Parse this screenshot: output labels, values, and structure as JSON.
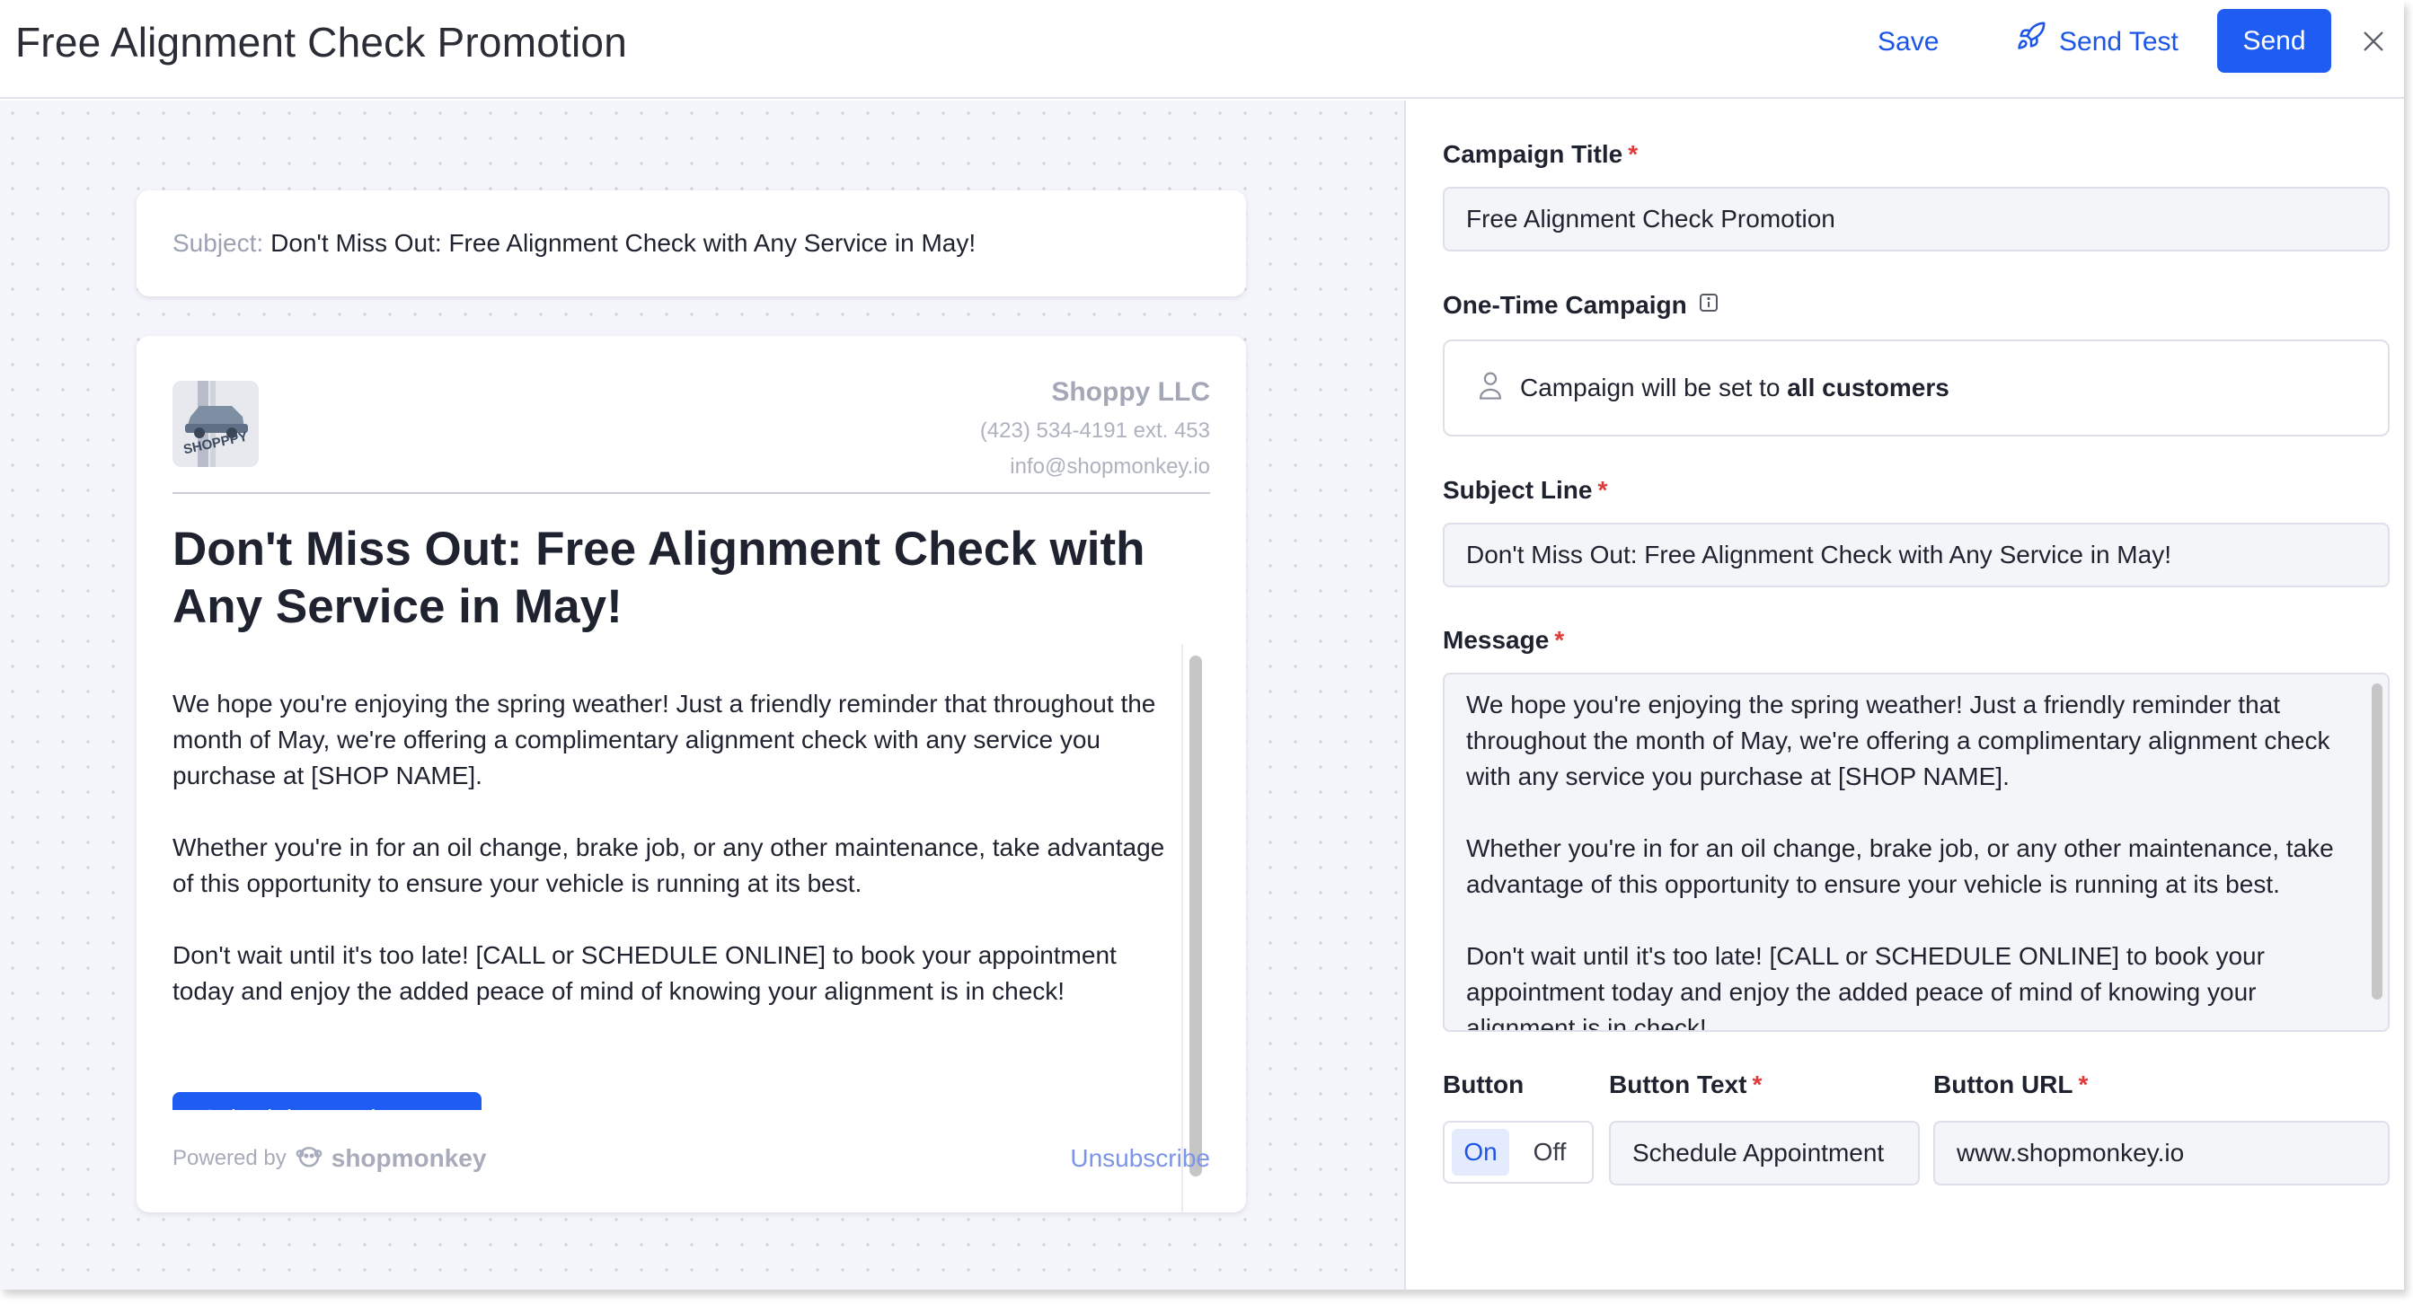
{
  "header": {
    "title": "Free Alignment Check Promotion",
    "save_label": "Save",
    "send_test_label": "Send Test",
    "send_label": "Send"
  },
  "preview": {
    "subject_prefix": "Subject:",
    "subject_text": "Don't Miss Out: Free Alignment Check with Any Service in May!",
    "logo_text": "SHOPPPY",
    "shop_name": "Shoppy LLC",
    "shop_phone": "(423) 534-4191 ext. 453",
    "shop_email": "info@shopmonkey.io",
    "heading": "Don't Miss Out: Free Alignment Check with Any Service in May!",
    "paragraphs": [
      "We hope you're enjoying the spring weather! Just a friendly reminder that throughout the month of May, we're offering a complimentary alignment check with any service you purchase at [SHOP NAME].",
      "Whether you're in for an oil change, brake job, or any other maintenance, take advantage of this opportunity to ensure your vehicle is running at its best.",
      "Don't wait until it's too late! [CALL or SCHEDULE ONLINE] to book your appointment today and enjoy the added peace of mind of knowing your alignment is in check!"
    ],
    "cta_label": "Schedule Appointment",
    "powered_by": "Powered by",
    "brand": "shopmonkey",
    "unsubscribe": "Unsubscribe"
  },
  "form": {
    "campaign_title_label": "Campaign Title",
    "campaign_title_value": "Free Alignment Check Promotion",
    "one_time_label": "One-Time Campaign",
    "audience_prefix": "Campaign will be set to",
    "audience_bold": "all customers",
    "subject_label": "Subject Line",
    "subject_value": "Don't Miss Out: Free Alignment Check with Any Service in May!",
    "message_label": "Message",
    "message_paragraphs": [
      "We hope you're enjoying the spring weather! Just a friendly reminder that throughout the month of May, we're offering a complimentary alignment check with any service you purchase at [SHOP NAME].",
      "Whether you're in for an oil change, brake job, or any other maintenance, take advantage of this opportunity to ensure your vehicle is running at its best.",
      "Don't wait until it's too late! [CALL or SCHEDULE ONLINE] to book your appointment today and enjoy the added peace of mind of knowing your alignment is in check!"
    ],
    "button_label": "Button",
    "toggle_on": "On",
    "toggle_off": "Off",
    "button_text_label": "Button Text",
    "button_text_value": "Schedule Appointment",
    "button_url_label": "Button URL",
    "button_url_value": "www.shopmonkey.io",
    "required_mark": "*"
  },
  "colors": {
    "primary": "#1f5df2",
    "link": "#1c56e8",
    "required": "#e03a3a",
    "preview_bg": "#f4f4fb"
  },
  "icons": [
    "send-test-rocket-icon",
    "close-icon",
    "info-icon",
    "person-icon",
    "shopmonkey-logo-icon"
  ]
}
